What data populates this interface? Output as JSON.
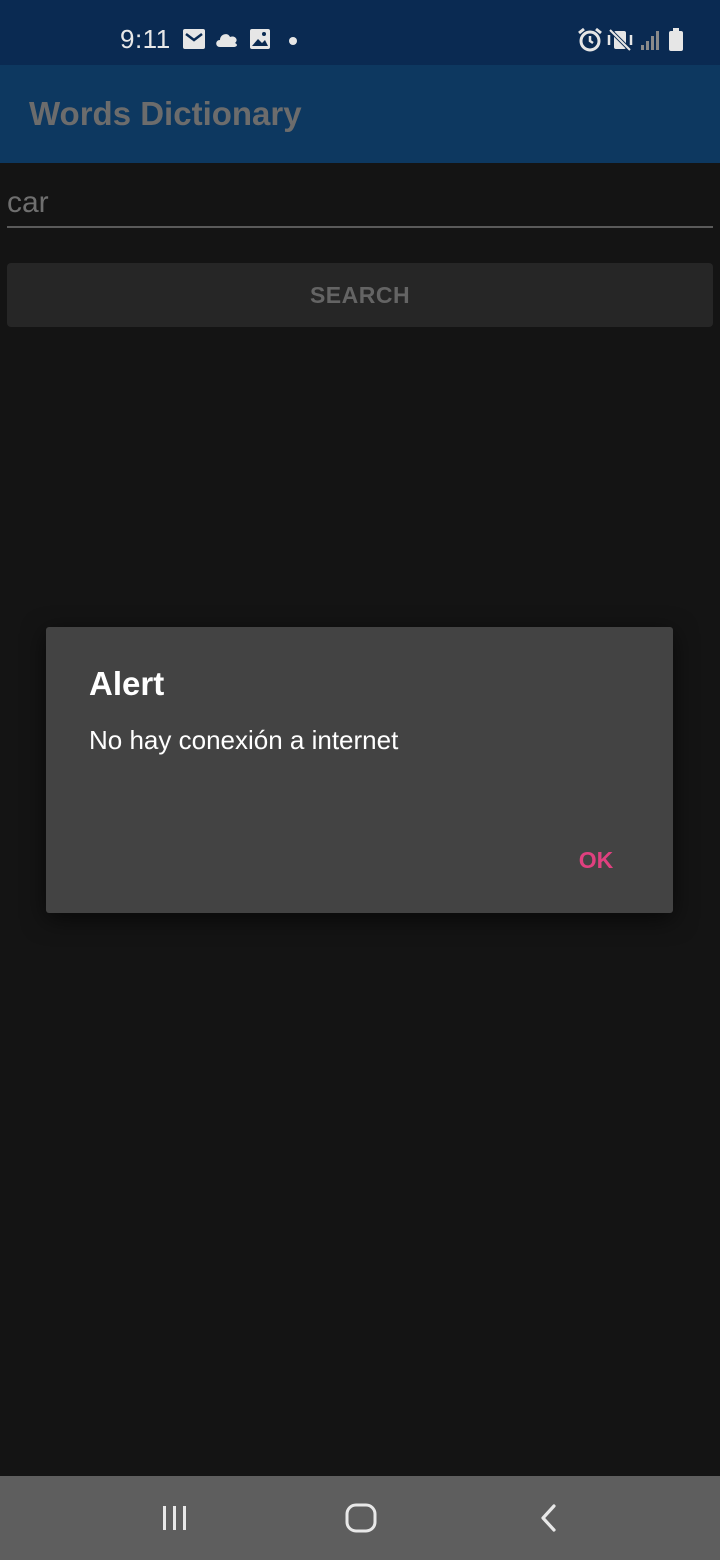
{
  "status_bar": {
    "time": "9:11",
    "left_icons": [
      "mail-icon",
      "cloud-icon",
      "image-icon",
      "dot-icon"
    ],
    "right_icons": [
      "alarm-icon",
      "vibrate-mute-icon",
      "signal-icon",
      "battery-icon"
    ]
  },
  "app_bar": {
    "title": "Words Dictionary"
  },
  "search": {
    "input_value": "car",
    "button_label": "SEARCH"
  },
  "dialog": {
    "title": "Alert",
    "message": "No hay conexión a internet",
    "ok_label": "OK"
  },
  "nav_bar": {
    "buttons": [
      "recent-apps-icon",
      "home-icon",
      "back-icon"
    ]
  },
  "colors": {
    "status_bar": "#0a2a52",
    "app_bar": "#0d3860",
    "background": "#141414",
    "dialog": "#434343",
    "accent": "#e0407f",
    "nav_bar": "#5e5e5e"
  }
}
